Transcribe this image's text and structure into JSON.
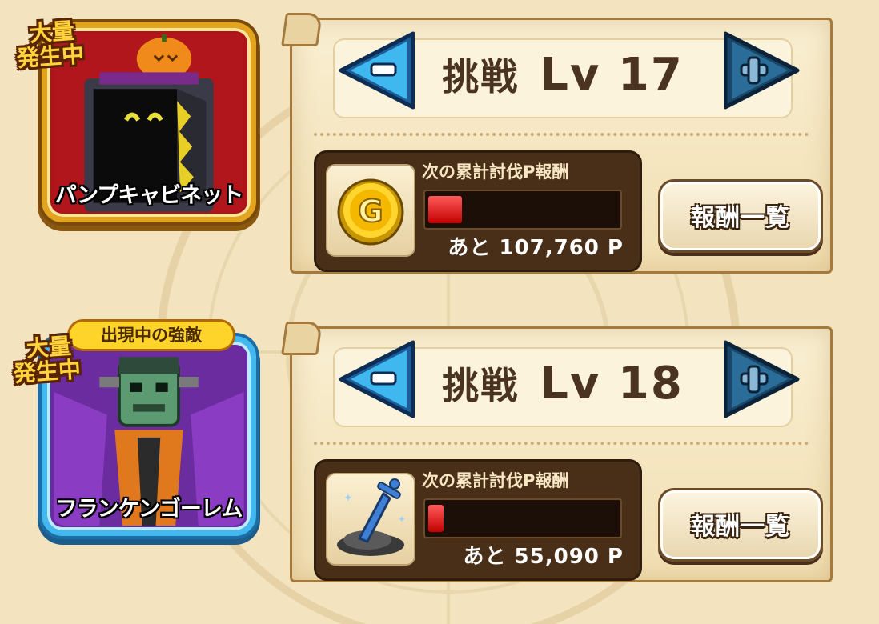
{
  "entries": [
    {
      "burst_line1": "大量",
      "burst_line2": "発生中",
      "monster_name": "パンプキャビネット",
      "challenge_label": "挑戦",
      "level": "Lv 17",
      "reward_label": "次の累計討伐P報酬",
      "progress": 0.18,
      "remaining": "あと 107,760 P",
      "reward_icon": "gold-coin-icon",
      "list_button": "報酬一覧",
      "frame_color": "#e1a41c"
    },
    {
      "badge": "出現中の強敵",
      "burst_line1": "大量",
      "burst_line2": "発生中",
      "monster_name": "フランケンゴーレム",
      "challenge_label": "挑戦",
      "level": "Lv 18",
      "reward_label": "次の累計討伐P報酬",
      "progress": 0.08,
      "remaining": "あと 55,090 P",
      "reward_icon": "sword-in-stone-icon",
      "list_button": "報酬一覧",
      "frame_color": "#43b8ee"
    }
  ]
}
